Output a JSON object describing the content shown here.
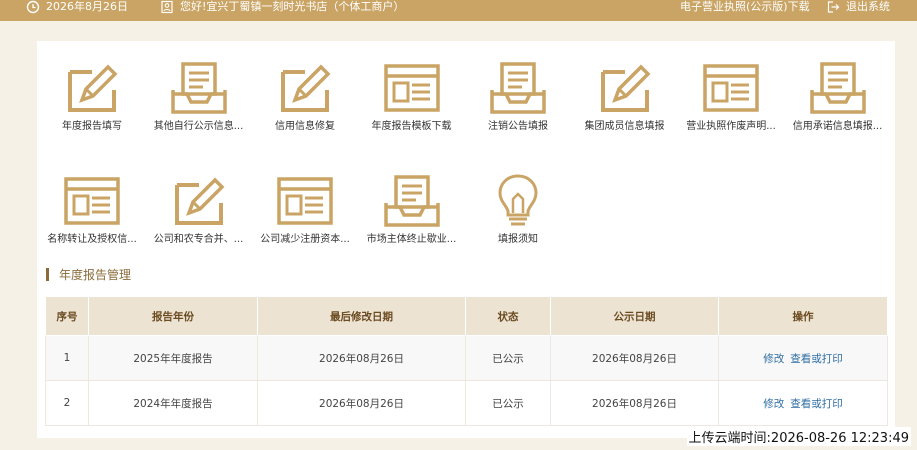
{
  "topbar": {
    "date": "2026年8月26日",
    "greeting": "您好!宜兴丁蜀镇一刻时光书店（个体工商户）",
    "license_link": "电子营业执照(公示版)下载",
    "logout": "退出系统",
    "bar_color": "#c9a464"
  },
  "tiles": [
    {
      "label": "年度报告填写",
      "icon": "pencil-form-icon"
    },
    {
      "label": "其他自行公示信息...",
      "icon": "inbox-tray-icon"
    },
    {
      "label": "信用信息修复",
      "icon": "pencil-form-icon"
    },
    {
      "label": "年度报告模板下载",
      "icon": "window-list-icon"
    },
    {
      "label": "注销公告填报",
      "icon": "inbox-tray-icon"
    },
    {
      "label": "集团成员信息填报",
      "icon": "pencil-form-icon"
    },
    {
      "label": "营业执照作废声明...",
      "icon": "window-list-icon"
    },
    {
      "label": "信用承诺信息填报...",
      "icon": "inbox-tray-icon"
    },
    {
      "label": "名称转让及授权信...",
      "icon": "window-list-icon"
    },
    {
      "label": "公司和农专合并、...",
      "icon": "pencil-form-icon"
    },
    {
      "label": "公司减少注册资本...",
      "icon": "window-list-icon"
    },
    {
      "label": "市场主体终止歇业...",
      "icon": "inbox-tray-icon"
    },
    {
      "label": "填报须知",
      "icon": "lightbulb-icon"
    }
  ],
  "section": {
    "title": "年度报告管理"
  },
  "table": {
    "headers": [
      "序号",
      "报告年份",
      "最后修改日期",
      "状态",
      "公示日期",
      "操作"
    ],
    "rows": [
      {
        "no": "1",
        "year": "2025年年度报告",
        "modified": "2026年08月26日",
        "status": "已公示",
        "published": "2026年08月26日",
        "edit": "修改",
        "view": "查看或打印"
      },
      {
        "no": "2",
        "year": "2024年年度报告",
        "modified": "2026年08月26日",
        "status": "已公示",
        "published": "2026年08月26日",
        "edit": "修改",
        "view": "查看或打印"
      }
    ]
  },
  "stamp": "上传云端时间:2026-08-26 12:23:49",
  "colors": {
    "accent": "#c9a464",
    "header_bg": "#ede3d2",
    "link": "#2e6da4"
  }
}
